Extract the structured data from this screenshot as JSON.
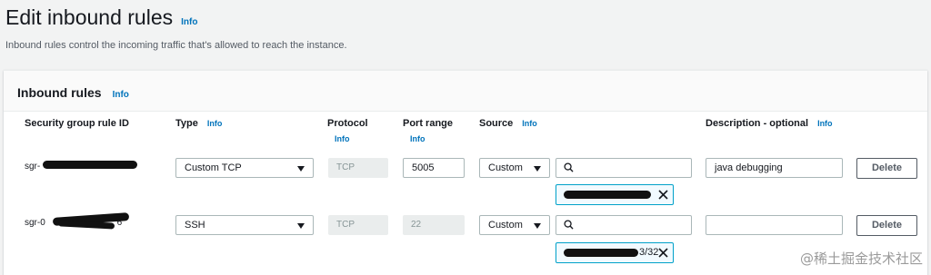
{
  "header": {
    "title": "Edit inbound rules",
    "info": "Info",
    "description": "Inbound rules control the incoming traffic that's allowed to reach the instance."
  },
  "panel": {
    "title": "Inbound rules",
    "info": "Info",
    "columns": {
      "rule_id": "Security group rule ID",
      "type": "Type",
      "type_info": "Info",
      "protocol": "Protocol",
      "protocol_info": "Info",
      "port_range": "Port range",
      "port_range_info": "Info",
      "source": "Source",
      "source_info": "Info",
      "description": "Description - optional",
      "description_info": "Info"
    },
    "rules": [
      {
        "rule_id_prefix": "sgr-",
        "type": "Custom TCP",
        "protocol": "TCP",
        "port_range": "5005",
        "source_type": "Custom",
        "source_search": "",
        "source_token_suffix": "",
        "description": "java debugging",
        "delete_label": "Delete"
      },
      {
        "rule_id_prefix": "sgr-0",
        "rule_id_suffix": "6",
        "type": "SSH",
        "protocol": "TCP",
        "port_range": "22",
        "source_type": "Custom",
        "source_search": "",
        "source_token_suffix": "3/32",
        "description": "",
        "delete_label": "Delete"
      }
    ]
  },
  "watermark": "@稀土掘金技术社区",
  "colors": {
    "link": "#0073bb",
    "token_border": "#00a1c9",
    "token_bg": "#f1faff"
  }
}
